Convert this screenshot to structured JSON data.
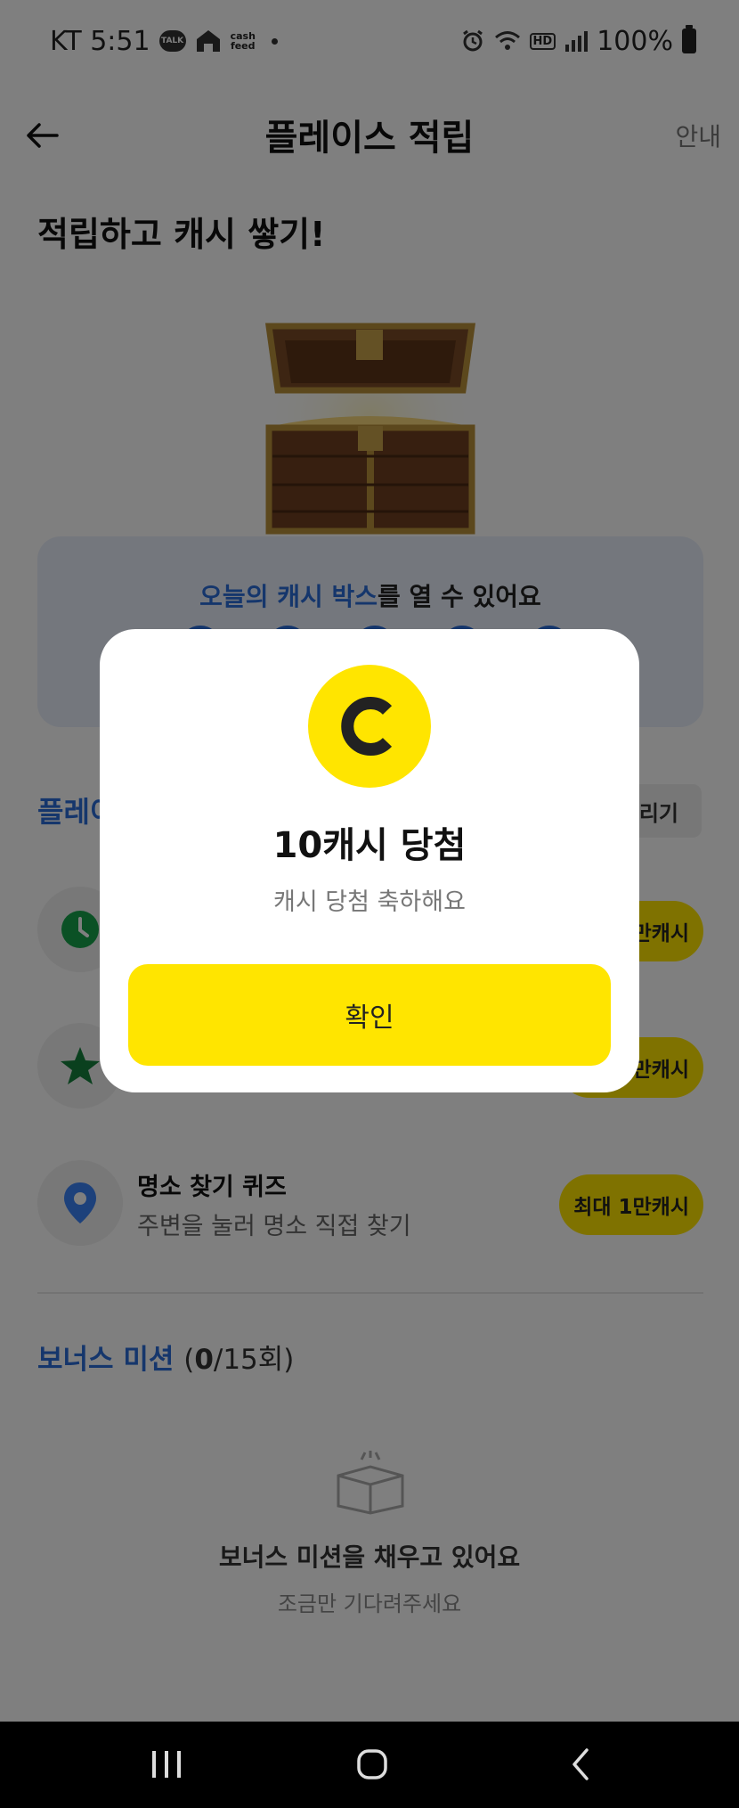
{
  "status_bar": {
    "carrier_time": "KT 5:51",
    "talk_icon_label": "TALK",
    "cashfeed_label_1": "cash",
    "cashfeed_label_2": "feed",
    "hd_label": "HD",
    "battery_text": "100%"
  },
  "header": {
    "title": "플레이스 적립",
    "guide_label": "안내"
  },
  "headline": "적립하고 캐시 쌓기!",
  "today_box": {
    "highlight": "오늘의 캐시 박스",
    "rest": "를 열 수 있어요",
    "slots": 5
  },
  "section": {
    "title": "플레이스 적립",
    "share_label": "친구에게 알리기"
  },
  "missions": [
    {
      "icon": "clock-icon",
      "name": "",
      "desc": "",
      "reward": "최대 1만캐시"
    },
    {
      "icon": "star-icon",
      "name": "",
      "desc": "",
      "reward": "최대 1만캐시"
    },
    {
      "icon": "location-pin-icon",
      "name": "명소 찾기 퀴즈",
      "desc": "주변을 눌러 명소 직접 찾기",
      "reward": "최대 1만캐시"
    }
  ],
  "bonus": {
    "title": "보너스 미션",
    "count_done": "0",
    "count_rest": "/15회)",
    "count_open": "(",
    "empty_title": "보너스 미션을 채우고 있어요",
    "empty_sub": "조금만 기다려주세요"
  },
  "modal": {
    "coin_letter": "C",
    "title": "10캐시 당첨",
    "subtitle": "캐시 당첨 축하해요",
    "confirm_label": "확인"
  },
  "colors": {
    "accent_yellow": "#ffe500",
    "accent_blue": "#2b6dd8",
    "clock_green": "#16a34a",
    "star_green": "#15803d",
    "pin_blue": "#3b82f6"
  }
}
